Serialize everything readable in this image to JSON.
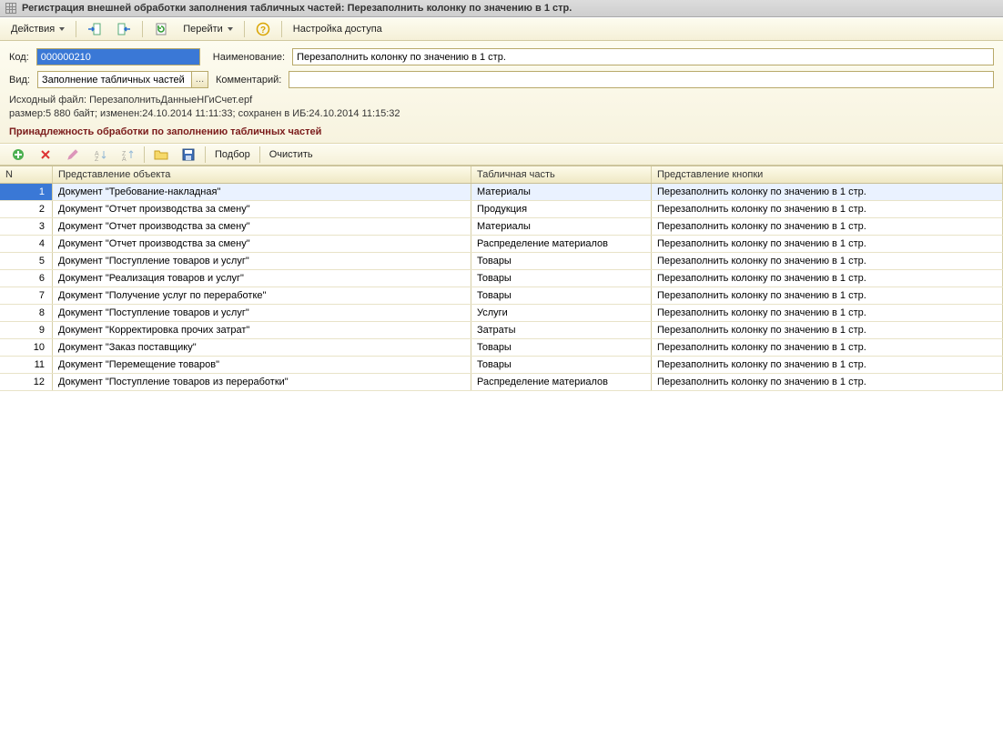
{
  "title": "Регистрация внешней обработки заполнения табличных частей: Перезаполнить колонку по значению в 1 стр.",
  "toolbar": {
    "actions": "Действия",
    "goto": "Перейти",
    "access": "Настройка доступа"
  },
  "form": {
    "code_label": "Код:",
    "code_value": "000000210",
    "name_label": "Наименование:",
    "name_value": "Перезаполнить колонку по значению в 1 стр.",
    "kind_label": "Вид:",
    "kind_value": "Заполнение табличных частей",
    "comment_label": "Комментарий:",
    "comment_value": "",
    "source_line1": "Исходный файл: ПерезаполнитьДанныеНГиСчет.epf",
    "source_line2": "размер:5 880 байт; изменен:24.10.2014 11:11:33; сохранен в ИБ:24.10.2014 11:15:32",
    "section_title": "Принадлежность обработки по заполнению табличных частей"
  },
  "tabletoolbar": {
    "select": "Подбор",
    "clear": "Очистить"
  },
  "columns": {
    "n": "N",
    "obj": "Представление объекта",
    "tab": "Табличная часть",
    "btn": "Представление кнопки"
  },
  "rows": [
    {
      "n": "1",
      "obj": "Документ \"Требование-накладная\"",
      "tab": "Материалы",
      "btn": "Перезаполнить колонку по значению в 1 стр."
    },
    {
      "n": "2",
      "obj": "Документ \"Отчет производства за смену\"",
      "tab": "Продукция",
      "btn": "Перезаполнить колонку по значению в 1 стр."
    },
    {
      "n": "3",
      "obj": "Документ \"Отчет производства за смену\"",
      "tab": "Материалы",
      "btn": "Перезаполнить колонку по значению в 1 стр."
    },
    {
      "n": "4",
      "obj": "Документ \"Отчет производства за смену\"",
      "tab": "Распределение материалов",
      "btn": "Перезаполнить колонку по значению в 1 стр."
    },
    {
      "n": "5",
      "obj": "Документ \"Поступление товаров и услуг\"",
      "tab": "Товары",
      "btn": "Перезаполнить колонку по значению в 1 стр."
    },
    {
      "n": "6",
      "obj": "Документ \"Реализация товаров и услуг\"",
      "tab": "Товары",
      "btn": "Перезаполнить колонку по значению в 1 стр."
    },
    {
      "n": "7",
      "obj": "Документ \"Получение услуг по переработке\"",
      "tab": "Товары",
      "btn": "Перезаполнить колонку по значению в 1 стр."
    },
    {
      "n": "8",
      "obj": "Документ \"Поступление товаров и услуг\"",
      "tab": "Услуги",
      "btn": "Перезаполнить колонку по значению в 1 стр."
    },
    {
      "n": "9",
      "obj": "Документ \"Корректировка прочих затрат\"",
      "tab": "Затраты",
      "btn": "Перезаполнить колонку по значению в 1 стр."
    },
    {
      "n": "10",
      "obj": "Документ \"Заказ поставщику\"",
      "tab": "Товары",
      "btn": "Перезаполнить колонку по значению в 1 стр."
    },
    {
      "n": "11",
      "obj": "Документ \"Перемещение товаров\"",
      "tab": "Товары",
      "btn": "Перезаполнить колонку по значению в 1 стр."
    },
    {
      "n": "12",
      "obj": "Документ \"Поступление товаров из переработки\"",
      "tab": "Распределение материалов",
      "btn": "Перезаполнить колонку по значению в 1 стр."
    }
  ]
}
